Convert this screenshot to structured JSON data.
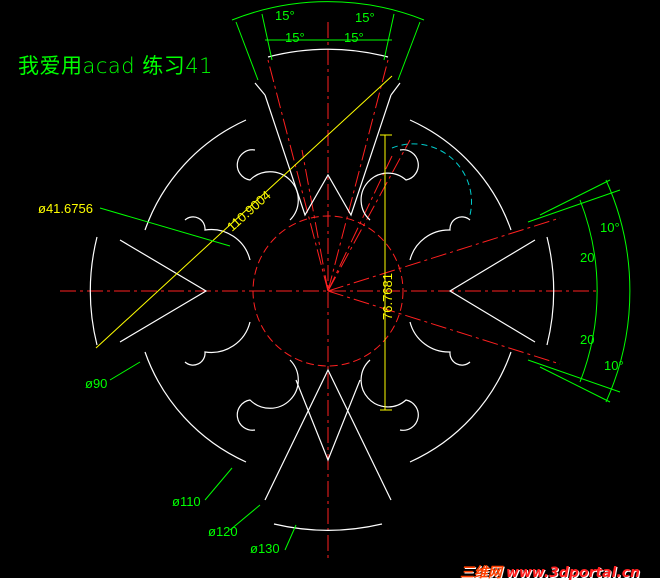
{
  "title": "我爱用acad 练习41",
  "watermark": {
    "cn": "三维网",
    "url": "www.3dportal.cn"
  },
  "colors": {
    "background": "#000000",
    "geometry": "#ffffff",
    "center": "#ff2020",
    "dimension": "#ffff00",
    "leader": "#00ff00",
    "arc": "#00cccc"
  },
  "dimensions": {
    "angle_15_a": "15°",
    "angle_15_b": "15°",
    "angle_15_c": "15°",
    "angle_15_d": "15°",
    "angle_10_a": "10°",
    "angle_10_b": "10°",
    "angle_20_a": "20",
    "angle_20_b": "20",
    "diag_length": "110.9004",
    "vert_length": "76.7681",
    "dia_41": "ø41.6756",
    "dia_90": "ø90",
    "dia_110": "ø110",
    "dia_120": "ø120",
    "dia_130": "ø130"
  }
}
